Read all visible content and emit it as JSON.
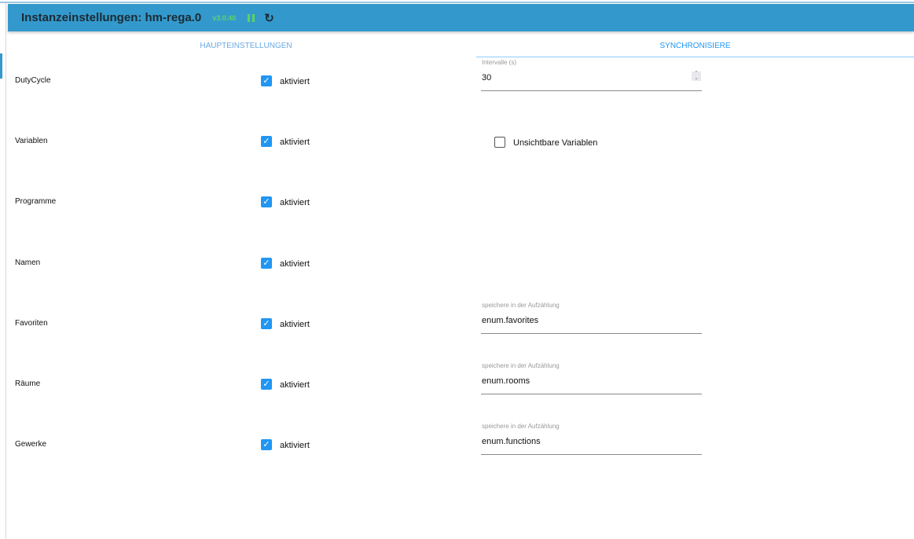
{
  "header": {
    "title": "Instanzeinstellungen: hm-rega.0",
    "version": "v3.0.40"
  },
  "tabs": [
    {
      "label": "HAUPTEINSTELLUNGEN"
    },
    {
      "label": "SYNCHRONISIERE"
    }
  ],
  "rows": [
    {
      "label": "DutyCycle",
      "checkbox": "aktiviert",
      "checked": true
    },
    {
      "label": "Variablen",
      "checkbox": "aktiviert",
      "checked": true
    },
    {
      "label": "Programme",
      "checkbox": "aktiviert",
      "checked": true
    },
    {
      "label": "Namen",
      "checkbox": "aktiviert",
      "checked": true
    },
    {
      "label": "Favoriten",
      "checkbox": "aktiviert",
      "checked": true
    },
    {
      "label": "Räume",
      "checkbox": "aktiviert",
      "checked": true
    },
    {
      "label": "Gewerke",
      "checkbox": "aktiviert",
      "checked": true
    }
  ],
  "interval": {
    "label": "Intervalle (s)",
    "value": "30"
  },
  "invisible_vars": {
    "label": "Unsichtbare Variablen",
    "checked": false
  },
  "enums": [
    {
      "label": "speichere in der Aufzählung",
      "value": "enum.favorites"
    },
    {
      "label": "speichere in der Aufzählung",
      "value": "enum.rooms"
    },
    {
      "label": "speichere in der Aufzählung",
      "value": "enum.functions"
    }
  ]
}
